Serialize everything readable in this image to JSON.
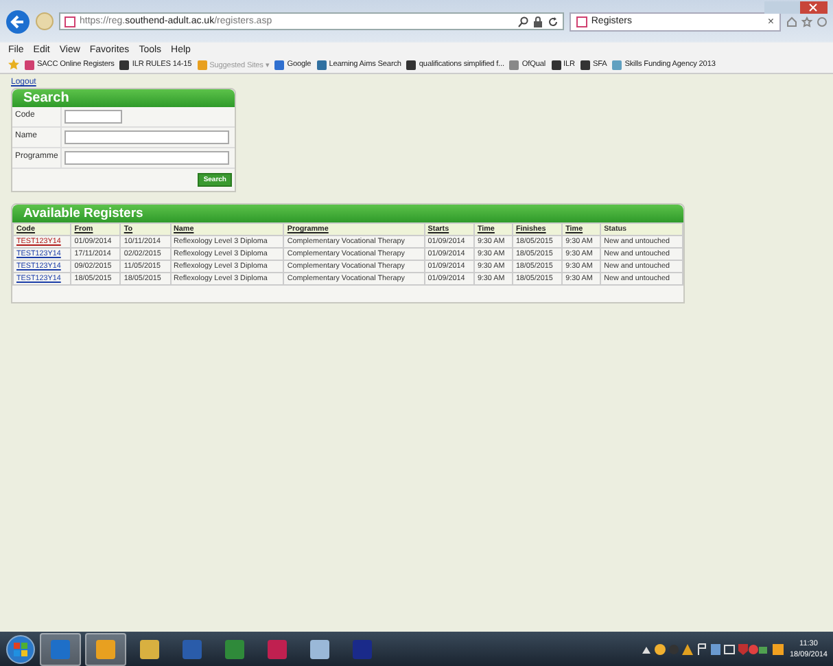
{
  "browser": {
    "address": "https://reg.**southend-adult.ac.uk**/registers.asp",
    "tab": {
      "title": "Registers",
      "close": "×"
    },
    "menu": [
      "File",
      "Edit",
      "View",
      "Favorites",
      "Tools",
      "Help"
    ],
    "favorites": [
      {
        "label": "SACC Online Registers",
        "dim": false
      },
      {
        "label": "ILR RULES 14-15",
        "dim": false
      },
      {
        "label": "Suggested Sites ▾",
        "dim": true
      },
      {
        "label": "Google",
        "dim": false
      },
      {
        "label": "Learning Aims Search",
        "dim": false
      },
      {
        "label": "qualifications simplified f...",
        "dim": false
      },
      {
        "label": "OfQual",
        "dim": false
      },
      {
        "label": "ILR",
        "dim": false
      },
      {
        "label": "SFA",
        "dim": false
      },
      {
        "label": "Skills Funding Agency 2013",
        "dim": false
      }
    ]
  },
  "page": {
    "logout": "Logout",
    "search": {
      "title": "Search",
      "fields": [
        {
          "label": "Code",
          "wide": false
        },
        {
          "label": "Name",
          "wide": true
        },
        {
          "label": "Programme",
          "wide": true
        }
      ],
      "button": "Search"
    },
    "registers": {
      "title": "Available Registers",
      "columns": [
        {
          "label": "Code",
          "link": true
        },
        {
          "label": "From",
          "link": true
        },
        {
          "label": "To",
          "link": true
        },
        {
          "label": "Name",
          "link": true
        },
        {
          "label": "Programme",
          "link": true
        },
        {
          "label": "Starts",
          "link": true
        },
        {
          "label": "Time",
          "link": true
        },
        {
          "label": "Finishes",
          "link": true
        },
        {
          "label": "Time",
          "link": true
        },
        {
          "label": "Status",
          "link": false
        }
      ],
      "rows": [
        {
          "visited": true,
          "cells": [
            "TEST123Y14",
            "01/09/2014",
            "10/11/2014",
            "Reflexology Level 3 Diploma",
            "Complementary Vocational Therapy",
            "01/09/2014",
            "9:30 AM",
            "18/05/2015",
            "9:30 AM",
            "New and untouched"
          ]
        },
        {
          "visited": false,
          "cells": [
            "TEST123Y14",
            "17/11/2014",
            "02/02/2015",
            "Reflexology Level 3 Diploma",
            "Complementary Vocational Therapy",
            "01/09/2014",
            "9:30 AM",
            "18/05/2015",
            "9:30 AM",
            "New and untouched"
          ]
        },
        {
          "visited": false,
          "cells": [
            "TEST123Y14",
            "09/02/2015",
            "11/05/2015",
            "Reflexology Level 3 Diploma",
            "Complementary Vocational Therapy",
            "01/09/2014",
            "9:30 AM",
            "18/05/2015",
            "9:30 AM",
            "New and untouched"
          ]
        },
        {
          "visited": false,
          "cells": [
            "TEST123Y14",
            "18/05/2015",
            "18/05/2015",
            "Reflexology Level 3 Diploma",
            "Complementary Vocational Therapy",
            "01/09/2014",
            "9:30 AM",
            "18/05/2015",
            "9:30 AM",
            "New and untouched"
          ]
        }
      ]
    }
  },
  "taskbar": {
    "apps": [
      {
        "color": "#1e6fc8",
        "active": true
      },
      {
        "color": "#e8a020",
        "active": true
      },
      {
        "color": "#d8b040",
        "active": false
      },
      {
        "color": "#2a5caa",
        "active": false
      },
      {
        "color": "#2f8a3a",
        "active": false
      },
      {
        "color": "#c02050",
        "active": false
      },
      {
        "color": "#9ab8d8",
        "active": false
      },
      {
        "color": "#1a2a8a",
        "active": false
      }
    ],
    "time": "11:30",
    "date": "18/09/2014"
  }
}
